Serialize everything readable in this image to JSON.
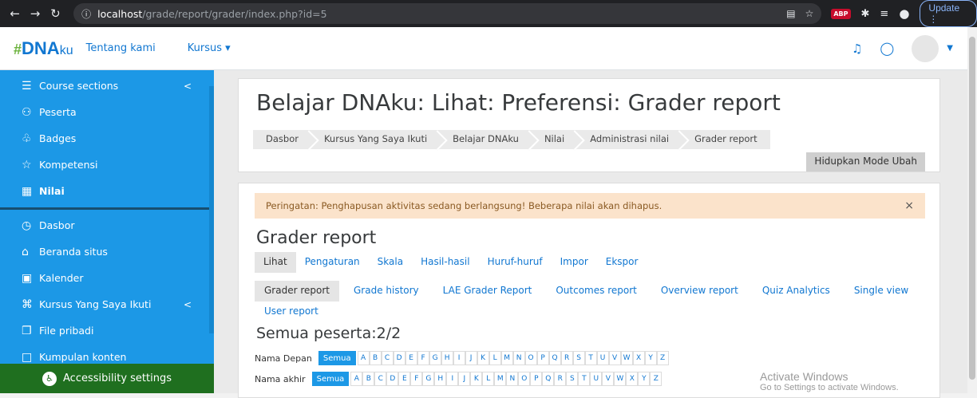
{
  "browser": {
    "url_host": "localhost",
    "url_path": "/grade/report/grader/index.php?id=5",
    "update_label": "Update"
  },
  "navbar": {
    "logo_hash": "#",
    "logo_dna": "DNA",
    "logo_ku": "ku",
    "about": "Tentang kami",
    "courses": "Kursus ▾"
  },
  "sidebar": {
    "items": [
      {
        "label": "Course sections"
      },
      {
        "label": "Peserta"
      },
      {
        "label": "Badges"
      },
      {
        "label": "Kompetensi"
      },
      {
        "label": "Nilai"
      },
      {
        "label": "Dasbor"
      },
      {
        "label": "Beranda situs"
      },
      {
        "label": "Kalender"
      },
      {
        "label": "Kursus Yang Saya Ikuti"
      },
      {
        "label": "File pribadi"
      },
      {
        "label": "Kumpulan konten"
      }
    ],
    "accessibility": "Accessibility settings"
  },
  "header": {
    "title": "Belajar DNAku: Lihat: Preferensi: Grader report",
    "breadcrumb": [
      "Dasbor",
      "Kursus Yang Saya Ikuti",
      "Belajar DNAku",
      "Nilai",
      "Administrasi nilai",
      "Grader report"
    ],
    "edit_button": "Hidupkan Mode Ubah"
  },
  "alert": {
    "text": "Peringatan: Penghapusan aktivitas sedang berlangsung! Beberapa nilai akan dihapus.",
    "close": "×"
  },
  "report": {
    "heading": "Grader report",
    "tabs1": [
      "Lihat",
      "Pengaturan",
      "Skala",
      "Hasil-hasil",
      "Huruf-huruf",
      "Impor",
      "Ekspor"
    ],
    "tabs2": [
      "Grader report",
      "Grade history",
      "LAE Grader Report",
      "Outcomes report",
      "Overview report",
      "Quiz Analytics",
      "Single view",
      "User report"
    ],
    "participants": "Semua peserta:2/2",
    "first_name_label": "Nama Depan",
    "last_name_label": "Nama akhir",
    "all_label": "Semua",
    "letters": [
      "A",
      "B",
      "C",
      "D",
      "E",
      "F",
      "G",
      "H",
      "I",
      "J",
      "K",
      "L",
      "M",
      "N",
      "O",
      "P",
      "Q",
      "R",
      "S",
      "T",
      "U",
      "V",
      "W",
      "X",
      "Y",
      "Z"
    ]
  },
  "watermark": {
    "line1": "Activate Windows",
    "line2": "Go to Settings to activate Windows."
  }
}
